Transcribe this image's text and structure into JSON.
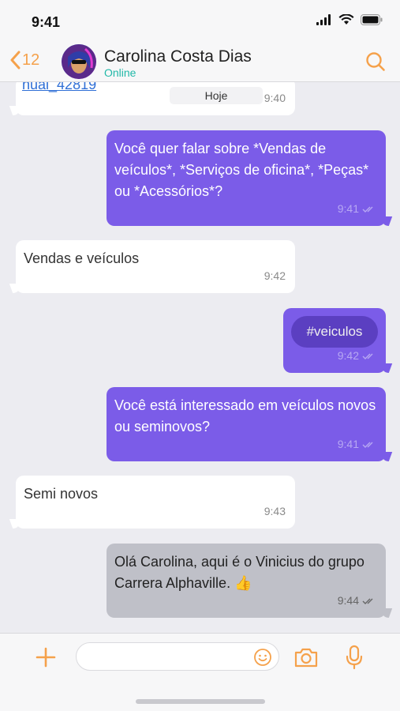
{
  "status_bar": {
    "time": "9:41"
  },
  "header": {
    "back_count": "12",
    "contact_name": "Carolina Costa Dias",
    "contact_status": "Online"
  },
  "messages": [
    {
      "id": "m0",
      "direction": "in",
      "link": "nual_42819",
      "date_chip": "Hoje",
      "time": "9:40"
    },
    {
      "id": "m1",
      "direction": "out",
      "text": "Você quer falar sobre *Vendas de veículos*, *Serviços de oficina*, *Peças* ou *Acessórios*?",
      "time": "9:41"
    },
    {
      "id": "m2",
      "direction": "in",
      "text": "Vendas e veículos",
      "time": "9:42"
    },
    {
      "id": "m3",
      "direction": "out",
      "tag": "#veiculos",
      "time": "9:42"
    },
    {
      "id": "m4",
      "direction": "out",
      "text": "Você está interessado em veículos novos ou seminovos?",
      "time": "9:41"
    },
    {
      "id": "m5",
      "direction": "in",
      "text": "Semi novos",
      "time": "9:43"
    },
    {
      "id": "m6",
      "direction": "out",
      "text": "Olá Carolina, aqui é o Vinicius do grupo Carrera Alphaville. 👍",
      "time": "9:44"
    }
  ],
  "input_bar": {
    "placeholder": ""
  },
  "colors": {
    "accent": "#f5a14b",
    "outgoing": "#7b5ce8",
    "incoming": "#ffffff",
    "pending": "#bfc0c8",
    "online": "#21b8a8"
  },
  "icons": {
    "back": "chevron-left-icon",
    "search": "search-icon",
    "plus": "plus-icon",
    "emoji": "emoji-icon",
    "camera": "camera-icon",
    "mic": "microphone-icon",
    "read": "double-check-icon"
  }
}
